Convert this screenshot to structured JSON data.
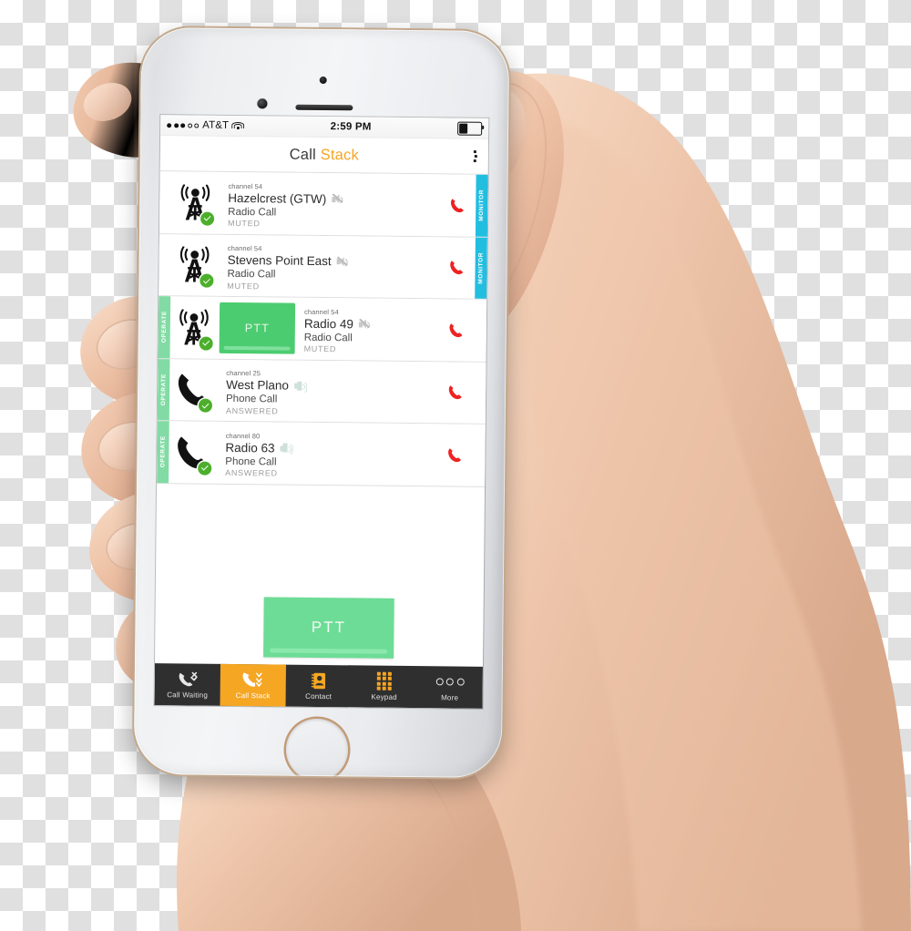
{
  "status_bar": {
    "carrier": "AT&T",
    "signal_filled": 3,
    "signal_empty": 2,
    "wifi_icon": "wifi-icon",
    "time": "2:59 PM",
    "battery_icon": "battery-icon",
    "battery_level_pct": 40
  },
  "nav": {
    "title_primary": "Call ",
    "title_accent": "Stack",
    "overflow_icon": "kebab-menu-icon",
    "accent_color": "#f5a623"
  },
  "colors": {
    "operate": "#82dba4",
    "monitor": "#22bee0",
    "ptt_green": "#4ccc70",
    "ptt_big_green": "#6ddc96",
    "end_call_red": "#ee2222",
    "tab_active": "#f5a623",
    "tab_bar": "#2f2f2f"
  },
  "calls": [
    {
      "side_tab_left": "",
      "side_tab_right": "MONITOR",
      "avatar_icon": "radio-tower-icon",
      "badge_icon": "check-badge-icon",
      "has_ptt": false,
      "ptt_label": "",
      "channel": "channel 54",
      "name": "Hazelcrest (GTW)",
      "speaker_icon": "speaker-muted-icon",
      "speaker_state": "muted",
      "type": "Radio Call",
      "status": "MUTED",
      "end_call_icon": "end-call-icon"
    },
    {
      "side_tab_left": "",
      "side_tab_right": "MONITOR",
      "avatar_icon": "radio-tower-icon",
      "badge_icon": "check-badge-icon",
      "has_ptt": false,
      "ptt_label": "",
      "channel": "channel 54",
      "name": "Stevens Point East",
      "speaker_icon": "speaker-muted-icon",
      "speaker_state": "muted",
      "type": "Radio Call",
      "status": "MUTED",
      "end_call_icon": "end-call-icon"
    },
    {
      "side_tab_left": "OPERATE",
      "side_tab_right": "",
      "avatar_icon": "radio-tower-icon",
      "badge_icon": "check-badge-icon",
      "has_ptt": true,
      "ptt_label": "PTT",
      "channel": "channel 54",
      "name": "Radio 49",
      "speaker_icon": "speaker-muted-icon",
      "speaker_state": "muted",
      "type": "Radio Call",
      "status": "MUTED",
      "end_call_icon": "end-call-icon"
    },
    {
      "side_tab_left": "OPERATE",
      "side_tab_right": "",
      "avatar_icon": "phone-handset-icon",
      "badge_icon": "check-badge-icon",
      "has_ptt": false,
      "ptt_label": "",
      "channel": "channel 25",
      "name": "West Plano",
      "speaker_icon": "speaker-on-icon",
      "speaker_state": "on",
      "type": "Phone Call",
      "status": "ANSWERED",
      "end_call_icon": "end-call-icon"
    },
    {
      "side_tab_left": "OPERATE",
      "side_tab_right": "",
      "avatar_icon": "phone-handset-icon",
      "badge_icon": "check-badge-icon",
      "has_ptt": false,
      "ptt_label": "",
      "channel": "channel 80",
      "name": "Radio 63",
      "speaker_icon": "speaker-on-icon",
      "speaker_state": "on",
      "type": "Phone Call",
      "status": "ANSWERED",
      "end_call_icon": "end-call-icon"
    }
  ],
  "ptt_button": {
    "label": "PTT"
  },
  "tabs": [
    {
      "label": "Call Waiting",
      "icon": "call-waiting-icon",
      "active": false
    },
    {
      "label": "Call Stack",
      "icon": "call-stack-icon",
      "active": true
    },
    {
      "label": "Contact",
      "icon": "contact-book-icon",
      "active": false
    },
    {
      "label": "Keypad",
      "icon": "keypad-icon",
      "active": false
    },
    {
      "label": "More",
      "icon": "more-dots-icon",
      "active": false
    }
  ]
}
